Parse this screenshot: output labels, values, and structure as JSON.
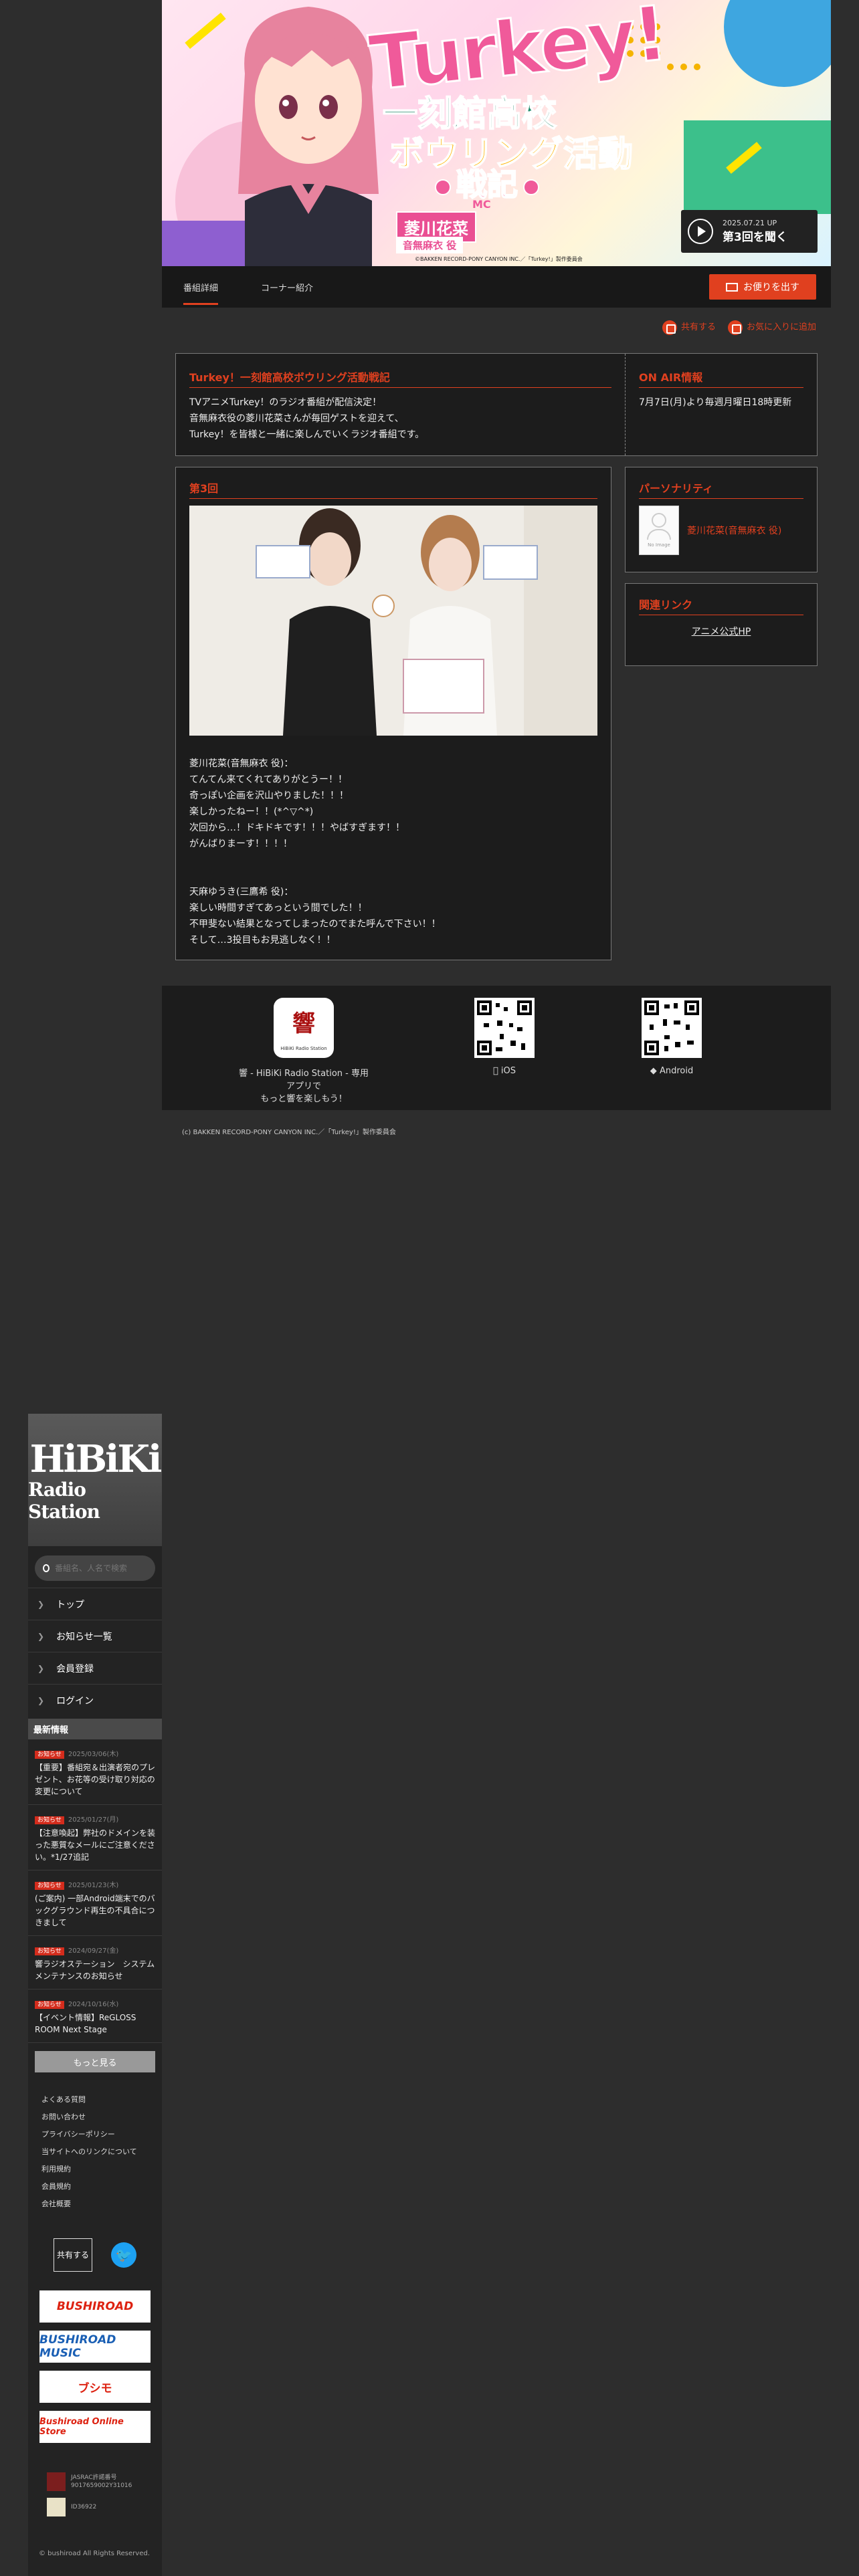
{
  "hero": {
    "title": "Turkey!",
    "sub1": "一刻館高校",
    "sub2": "ボウリング活動",
    "sub3": "戦記",
    "mc_label": "MC",
    "mc_name": "菱川花菜",
    "mc_role": "音無麻衣 役",
    "copyright": "©BAKKEN RECORD-PONY CANYON INC.／「Turkey!」製作委員会",
    "play_date": "2025.07.21 UP",
    "play_label": "第3回を聞く"
  },
  "tabs": {
    "detail": "番組詳細",
    "corner": "コーナー紹介"
  },
  "mail_button": "お便りを出す",
  "share": {
    "share_label": "共有する",
    "favorite_label": "お気に入りに追加"
  },
  "program": {
    "title": "Turkey！一刻館高校ボウリング活動戦記",
    "desc1": "TVアニメTurkey！のラジオ番組が配信決定！",
    "desc2": "音無麻衣役の菱川花菜さんが毎回ゲストを迎えて、",
    "desc3": "Turkey！を皆様と一緒に楽しんでいくラジオ番組です。",
    "onair_title": "ON AIR情報",
    "onair_text": "7月7日(月)より毎週月曜日18時更新"
  },
  "episode": {
    "title": "第3回",
    "lines": [
      "菱川花菜(音無麻衣 役)：",
      "てんてん来てくれてありがとうー！！",
      "奇っぽい企画を沢山やりました！！！",
      "楽しかったねー！！(*^▽^*)",
      "次回から…！ドキドキです！！！やばすぎます！！",
      "がんばりまーす！！！！",
      "",
      "",
      "天麻ゆうき(三鷹希 役)：",
      "楽しい時間すぎてあっという間でした！！",
      "不甲斐ない結果となってしまったのでまた呼んで下さい！！",
      "そして…3投目もお見逃しなく！！"
    ]
  },
  "personality": {
    "title": "パーソナリティ",
    "no_image": "No Image",
    "name": "菱川花菜(音無麻衣 役)"
  },
  "related": {
    "title": "関連リンク",
    "link": "アニメ公式HP"
  },
  "apps": {
    "app_name_line1": "響 - HiBiKi Radio Station - 専用アプリで",
    "app_name_line2": "もっと響を楽しもう！",
    "ios": "iOS",
    "android": "Android",
    "logo_text": "HiBiKi Radio Station"
  },
  "footer_copy": "(c) BAKKEN RECORD-PONY CANYON INC.／「Turkey!」製作委員会",
  "sidebar": {
    "logo_line1": "HiBiKi",
    "logo_line2": "Radio Station",
    "search_placeholder": "番組名、人名で検索",
    "nav": [
      "トップ",
      "お知らせ一覧",
      "会員登録",
      "ログイン"
    ],
    "news_heading": "最新情報",
    "news": [
      {
        "badge": "お知らせ",
        "date": "2025/03/06(木)",
        "title": "【重要】番組宛＆出演者宛のプレゼント、お花等の受け取り対応の変更について"
      },
      {
        "badge": "お知らせ",
        "date": "2025/01/27(月)",
        "title": "【注意喚起】弊社のドメインを装った悪質なメールにご注意ください。*1/27追記"
      },
      {
        "badge": "お知らせ",
        "date": "2025/01/23(木)",
        "title": "(ご案内) 一部Android端末でのバックグラウンド再生の不具合につきまして"
      },
      {
        "badge": "お知らせ",
        "date": "2024/09/27(金)",
        "title": "響ラジオステーション　システムメンテナンスのお知らせ"
      },
      {
        "badge": "お知らせ",
        "date": "2024/10/16(水)",
        "title": "【イベント情報】ReGLOSS ROOM Next Stage"
      }
    ],
    "more": "もっと見る",
    "links": [
      "よくある質問",
      "お問い合わせ",
      "プライバシーポリシー",
      "当サイトへのリンクについて",
      "利用規約",
      "会員規約",
      "会社概要"
    ],
    "share_label": "共有する",
    "banners": [
      "BUSHIROAD",
      "BUSHIROAD MUSIC",
      "ブシモ",
      "Bushiroad Online Store"
    ],
    "lic1_line1": "JASRAC許諾番号",
    "lic1_line2": "9017659002Y31016",
    "lic2": "ID36922",
    "copyright": "© bushiroad All Rights Reserved."
  }
}
